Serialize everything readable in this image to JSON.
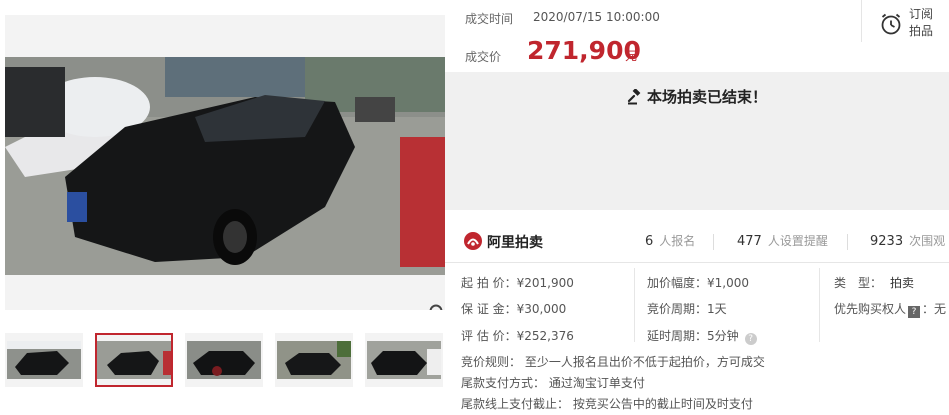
{
  "gallery": {
    "thumb_count": 5,
    "active_thumb": 2
  },
  "deal": {
    "time_label": "成交时间",
    "time_value": "2020/07/15 10:00:00",
    "price_label": "成交价",
    "price_value": "271,900",
    "price_unit": "元"
  },
  "subscribe": {
    "line1": "订阅",
    "line2": "拍品"
  },
  "status": {
    "ended_text": "本场拍卖已结束！"
  },
  "platform": {
    "brand": "阿里拍卖"
  },
  "stats": {
    "signups": "6",
    "signups_unit": "人报名",
    "reminders": "477",
    "reminders_unit": "人设置提醒",
    "views": "9233",
    "views_unit": "次围观"
  },
  "details": {
    "start_price": "起 拍 价：¥201,900",
    "deposit": "保 证 金：¥30,000",
    "valuation": "评 估 价：¥252,376",
    "increment": "加价幅度：¥1,000",
    "bid_period": "竞价周期：1天",
    "extension": "延时周期：5分钟",
    "type_label": "类　型：",
    "type_value": "拍卖",
    "priority_label": "优先购买权人",
    "priority_badge": "?",
    "priority_value": "：无"
  },
  "rules": {
    "bid_rule": "竞价规则：  至少一人报名且出价不低于起拍价，方可成交",
    "payment_method": "尾款支付方式：  通过淘宝订单支付",
    "payment_deadline": "尾款线上支付截止：  按竞买公告中的截止时间及时支付"
  },
  "colors": {
    "accent": "#c0262e",
    "panel_bg": "#f0f0f0"
  }
}
